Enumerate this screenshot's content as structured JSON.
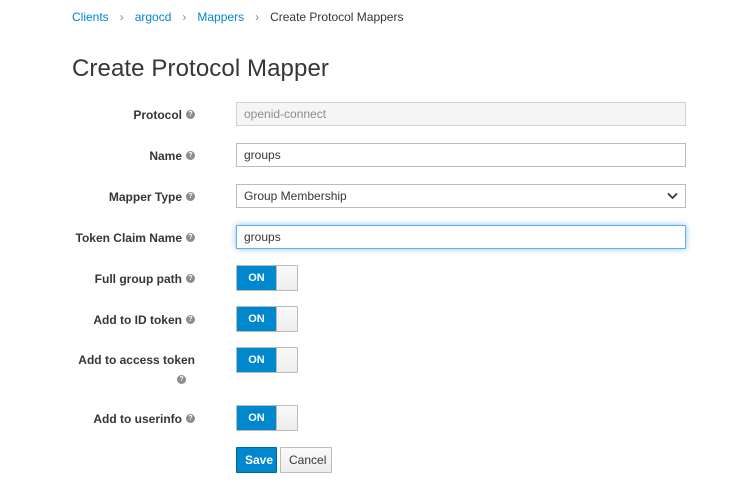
{
  "breadcrumb": {
    "items": [
      "Clients",
      "argocd",
      "Mappers"
    ],
    "separator": "›",
    "current": "Create Protocol Mappers"
  },
  "page_title": "Create Protocol Mapper",
  "form": {
    "protocol": {
      "label": "Protocol",
      "value": "openid-connect"
    },
    "name": {
      "label": "Name",
      "value": "groups"
    },
    "mapper_type": {
      "label": "Mapper Type",
      "value": "Group Membership"
    },
    "token_claim_name": {
      "label": "Token Claim Name",
      "value": "groups"
    },
    "full_group_path": {
      "label": "Full group path",
      "state": "ON"
    },
    "add_to_id_token": {
      "label": "Add to ID token",
      "state": "ON"
    },
    "add_to_access_token": {
      "label": "Add to access token",
      "state": "ON"
    },
    "add_to_userinfo": {
      "label": "Add to userinfo",
      "state": "ON"
    }
  },
  "buttons": {
    "save": "Save",
    "cancel": "Cancel"
  },
  "icons": {
    "help": "help-circle-icon",
    "select": "chevron-down-icon"
  },
  "colors": {
    "accent": "#0088ce",
    "text": "#363636",
    "focus": "#66afe9"
  }
}
